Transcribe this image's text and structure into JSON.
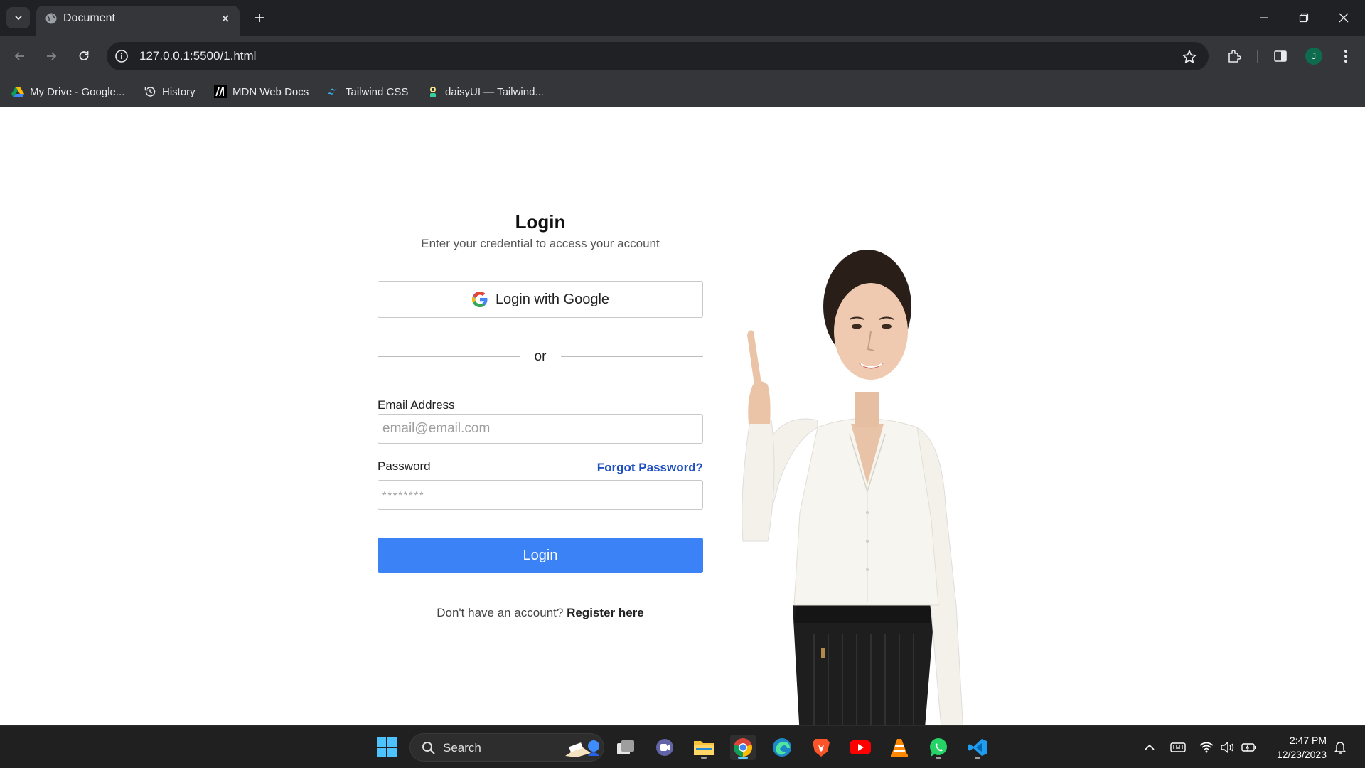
{
  "browser": {
    "tab_title": "Document",
    "url": "127.0.0.1:5500/1.html",
    "profile_initial": "J",
    "bookmarks": [
      {
        "label": "My Drive - Google...",
        "icon": "google-drive-icon"
      },
      {
        "label": "History",
        "icon": "history-icon"
      },
      {
        "label": "MDN Web Docs",
        "icon": "mdn-icon"
      },
      {
        "label": "Tailwind CSS",
        "icon": "tailwind-icon"
      },
      {
        "label": "daisyUI — Tailwind...",
        "icon": "daisyui-icon"
      }
    ]
  },
  "login": {
    "title": "Login",
    "subtitle": "Enter your credential to access your account",
    "google_button": "Login with Google",
    "divider": "or",
    "email_label": "Email Address",
    "email_placeholder": "email@email.com",
    "password_label": "Password",
    "password_placeholder": "********",
    "forgot_link": "Forgot Password?",
    "submit_button": "Login",
    "register_prompt": "Don't have an account?",
    "register_link": "Register here"
  },
  "taskbar": {
    "search_label": "Search",
    "time": "2:47 PM",
    "date": "12/23/2023",
    "apps": [
      "start-icon",
      "task-view-icon",
      "teams-icon",
      "file-explorer-icon",
      "chrome-icon",
      "edge-icon",
      "brave-icon",
      "youtube-icon",
      "vlc-icon",
      "whatsapp-icon",
      "vscode-icon"
    ]
  },
  "colors": {
    "accent": "#3b82f6",
    "link": "#1f4fbf",
    "chrome_dark": "#202124",
    "chrome_toolbar": "#35363a"
  }
}
